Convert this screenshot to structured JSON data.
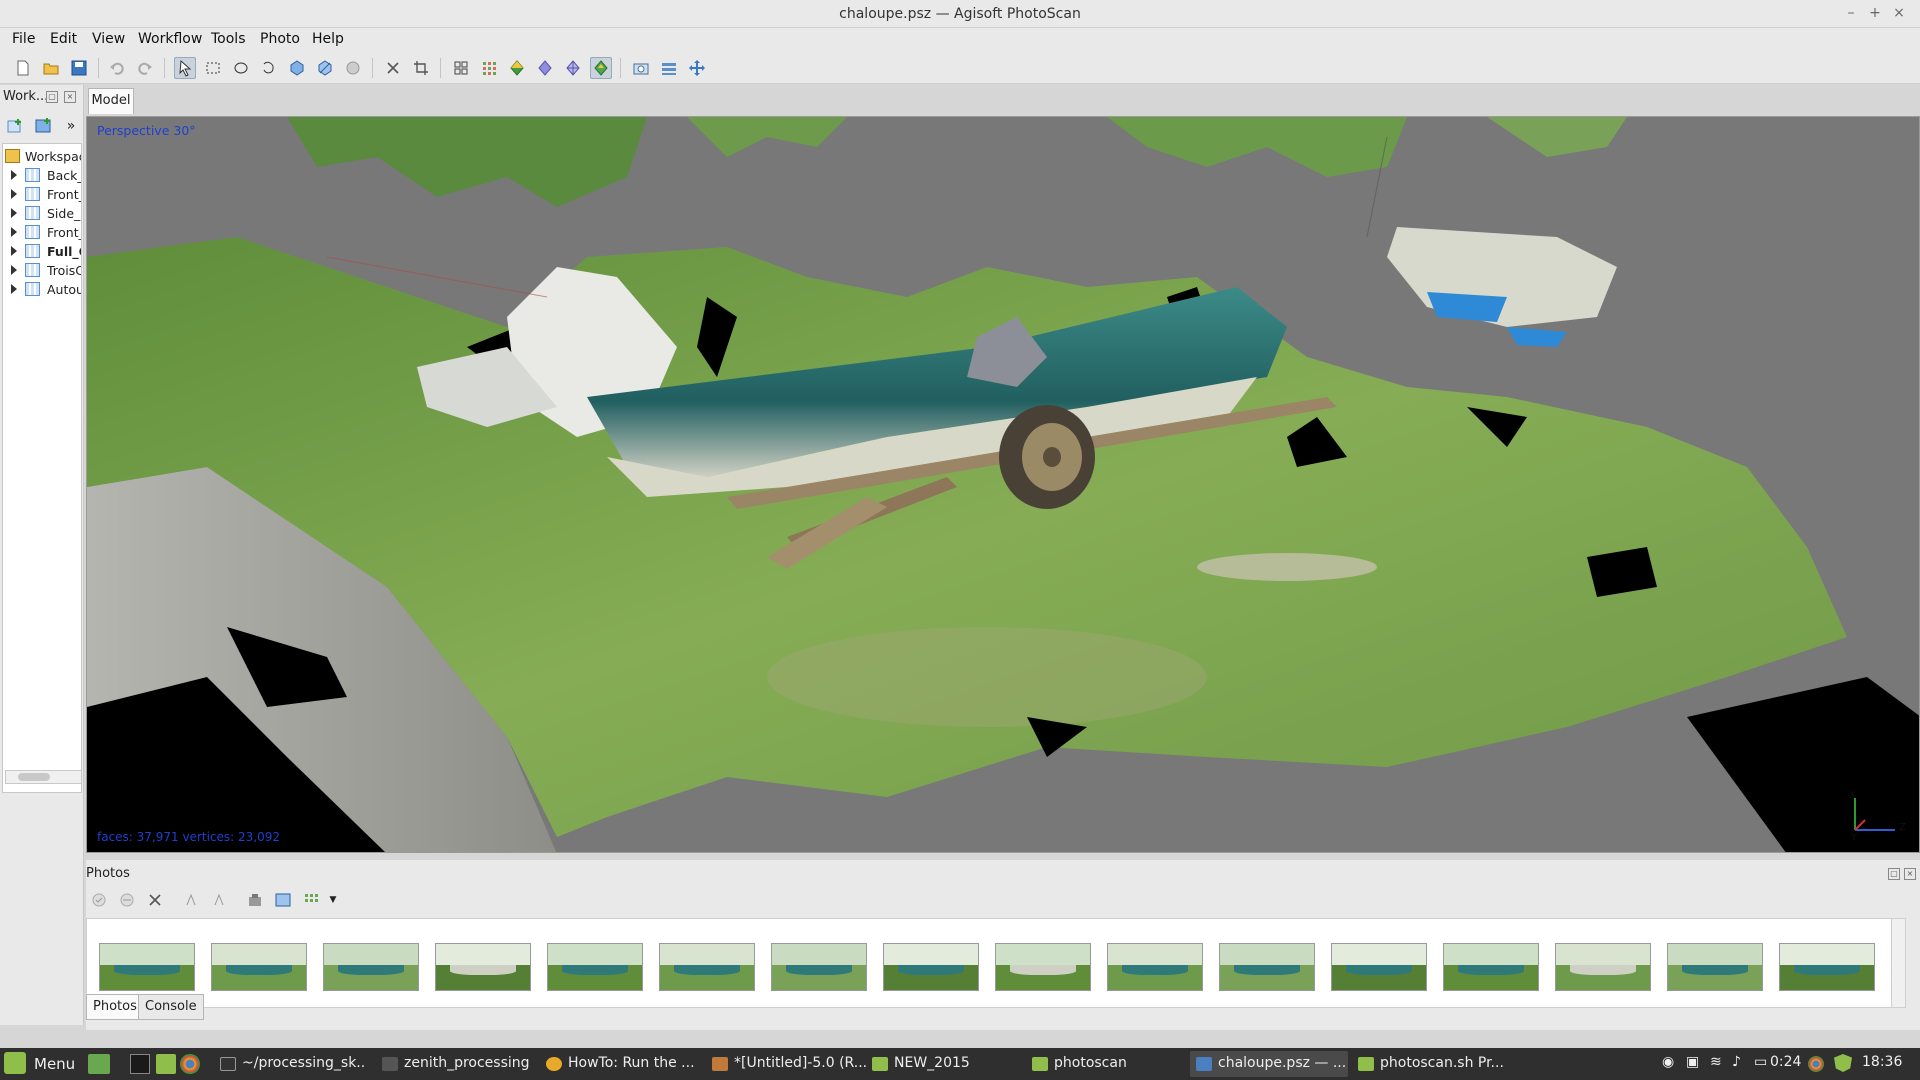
{
  "window": {
    "title": "chaloupe.psz — Agisoft PhotoScan",
    "minimize_icon": "–",
    "maximize_icon": "+",
    "close_icon": "×"
  },
  "menu": [
    "File",
    "Edit",
    "View",
    "Workflow",
    "Tools",
    "Photo",
    "Help"
  ],
  "toolbar": {
    "icons": [
      "new-icon",
      "open-icon",
      "save-icon",
      "undo-icon",
      "redo-icon",
      "navigation-icon",
      "rectangle-selection-icon",
      "circle-selection-icon",
      "free-form-selection-icon",
      "resize-region-icon",
      "rotate-region-icon",
      "rotate-object-icon",
      "delete-selection-icon",
      "crop-selection-icon",
      "show-cameras-icon",
      "point-cloud-icon",
      "shaded-model-icon",
      "solid-model-icon",
      "wireframe-icon",
      "textured-model-icon",
      "capture-view-icon",
      "show-aligned-cameras-icon",
      "move-region-icon"
    ],
    "active_tool": "textured-model-icon"
  },
  "workspace": {
    "title": "Work...",
    "tree": [
      {
        "label": "Workspac",
        "root": true
      },
      {
        "label": "Back_"
      },
      {
        "label": "Front_"
      },
      {
        "label": "Side_C"
      },
      {
        "label": "Front_"
      },
      {
        "label": "Full_C",
        "bold": true
      },
      {
        "label": "TroisC"
      },
      {
        "label": "Autou"
      }
    ]
  },
  "model_tab": "Model",
  "viewport": {
    "view_label": "Perspective 30°",
    "stats": "faces: 37,971 vertices: 23,092",
    "axes": {
      "x": "X",
      "y": "Y",
      "z": "Z"
    },
    "colors": {
      "background": "#787878",
      "grass": "#7aa04a",
      "boat": "#2f7a78"
    }
  },
  "photos_panel": {
    "title": "Photos",
    "tab_photos": "Photos",
    "tab_console": "Console",
    "thumbnail_count": 16
  },
  "taskbar": {
    "menu_label": "Menu",
    "tasks": [
      {
        "label": "~/processing_sk...",
        "icon_color": "#333333"
      },
      {
        "label": "zenith_processing",
        "icon_color": "#555555"
      },
      {
        "label": "HowTo: Run the ...",
        "icon_color": "#e8a92a"
      },
      {
        "label": "*[Untitled]-5.0 (R...",
        "icon_color": "#c07a3a"
      },
      {
        "label": "NEW_2015",
        "icon_color": "#8fbf4a"
      },
      {
        "label": "photoscan",
        "icon_color": "#8fbf4a"
      },
      {
        "label": "chaloupe.psz — ...",
        "icon_color": "#4a7fc0",
        "active": true
      },
      {
        "label": "photoscan.sh Pr...",
        "icon_color": "#8fbf4a"
      }
    ],
    "battery": "0:24",
    "clock": "18:36"
  }
}
